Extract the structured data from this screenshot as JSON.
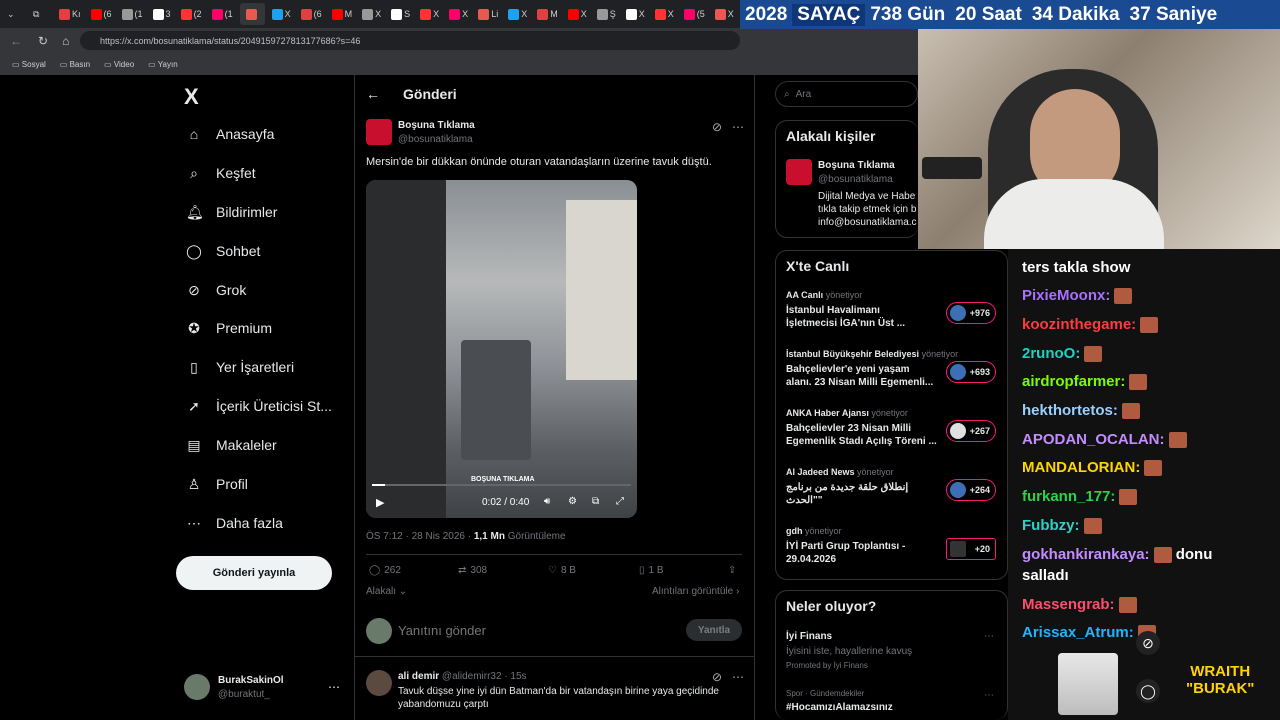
{
  "browser": {
    "tabs": [
      "Kı",
      "(6",
      "(1",
      "3",
      "(2",
      "(1",
      "",
      "X",
      "(6",
      "M",
      "X",
      "S",
      "X",
      "X",
      "Li",
      "X",
      "M",
      "X",
      "Ş",
      "X",
      "X",
      "(5",
      "X",
      "X",
      "X",
      "X",
      "X"
    ],
    "url": "https://x.com/bosunatiklama/status/2049159727813177686?s=46",
    "bookmarks": [
      "Sosyal",
      "Basın",
      "Video",
      "Yayın"
    ]
  },
  "counter": {
    "year": "2028",
    "label": "SAYAÇ",
    "days": "738 Gün",
    "hours": "20 Saat",
    "minutes": "34 Dakika",
    "seconds": "37 Saniye"
  },
  "sidebar": {
    "logo": "X",
    "items": [
      {
        "label": "Anasayfa",
        "icon": "home-icon"
      },
      {
        "label": "Keşfet",
        "icon": "search-icon"
      },
      {
        "label": "Bildirimler",
        "icon": "bell-icon"
      },
      {
        "label": "Sohbet",
        "icon": "chat-icon"
      },
      {
        "label": "Grok",
        "icon": "grok-icon"
      },
      {
        "label": "Premium",
        "icon": "verified-icon"
      },
      {
        "label": "Yer İşaretleri",
        "icon": "bookmark-icon"
      },
      {
        "label": "İçerik Üreticisi St...",
        "icon": "rocket-icon"
      },
      {
        "label": "Makaleler",
        "icon": "article-icon"
      },
      {
        "label": "Profil",
        "icon": "person-icon"
      },
      {
        "label": "Daha fazla",
        "icon": "more-icon"
      }
    ],
    "post_button": "Gönderi yayınla",
    "account": {
      "name": "BurakSakinOl",
      "handle": "@buraktut_"
    }
  },
  "post": {
    "header": "Gönderi",
    "author": "Boşuna Tıklama",
    "handle": "@bosunatiklama",
    "text": "Mersin'de bir dükkan önünde oturan vatandaşların üzerine tavuk düştü.",
    "video": {
      "time": "0:02 / 0:40",
      "progress": 0.05,
      "watermark": "BOŞUNA TIKLAMA"
    },
    "meta_time": "ÖS 7:12 · 28 Nis 2026 ·",
    "views": "1,1 Mn",
    "views_label": "Görüntüleme",
    "stats": {
      "replies": "262",
      "reposts": "308",
      "likes": "8 B",
      "bookmarks": "1 B"
    },
    "sort": "Alakalı",
    "quotes": "Alıntıları görüntüle",
    "reply_placeholder": "Yanıtını gönder",
    "reply_button": "Yanıtla"
  },
  "reply": {
    "author": "ali demir",
    "handle": "@alidemirr32 · 15s",
    "text": "Tavuk düşse yine iyi dün Batman'da bir vatandaşın birine yaya geçidinde yabandomuzu çarptı"
  },
  "right": {
    "search_placeholder": "Ara",
    "related_title": "Alakalı kişiler",
    "related": {
      "name": "Boşuna Tıklama",
      "handle": "@bosunatiklama",
      "bio1": "Dijital Medya ve Habe",
      "bio2": "tıkla takip etmek için b",
      "bio3": "info@bosunatiklama.c"
    },
    "live_title": "X'te Canlı",
    "live": [
      {
        "source": "AA Canlı",
        "role": "yönetiyor",
        "text1": "İstanbul Havalimanı",
        "text2": "İşletmecisi İGA'nın Üst ...",
        "count": "+976"
      },
      {
        "source": "İstanbul Büyükşehir Belediyesi",
        "role": "yönetiyor",
        "text1": "Bahçelievler'e yeni yaşam",
        "text2": "alanı. 23 Nisan Milli Egemenli...",
        "count": "+693"
      },
      {
        "source": "ANKA Haber Ajansı",
        "role": "yönetiyor",
        "text1": "Bahçelievler 23 Nisan Milli",
        "text2": "Egemenlik Stadı Açılış Töreni ...",
        "count": "+267"
      },
      {
        "source": "Al Jadeed News",
        "role": "yönetiyor",
        "text1": "إنطلاق حلقة جديدة من برنامج",
        "text2": "الحدث\"\"",
        "count": "+264"
      },
      {
        "source": "gdh",
        "role": "yönetiyor",
        "text1": "İYİ Parti Grup Toplantısı -",
        "text2": "29.04.2026",
        "count": "+20"
      }
    ],
    "happening_title": "Neler oluyor?",
    "happening": [
      {
        "title": "İyi Finans",
        "sub": "İyisini iste, hayallerine kavuş",
        "promo": "Promoted by İyi Finans"
      },
      {
        "title": "#HocamızıAlamazsınız",
        "sub": "Spor · Gündemdekiler"
      }
    ]
  },
  "chat": {
    "title": "ters takla show",
    "lines": [
      {
        "user": "PixieMoonx:",
        "color": "#a970ff",
        "msg": ""
      },
      {
        "user": "koozinthegame:",
        "color": "#ff3b3b",
        "msg": ""
      },
      {
        "user": "2runoO:",
        "color": "#1fd1c2",
        "msg": ""
      },
      {
        "user": "airdropfarmer:",
        "color": "#7cfc00",
        "msg": ""
      },
      {
        "user": "hekthortetos:",
        "color": "#9ad0ff",
        "msg": ""
      },
      {
        "user": "APODAN_OCALAN:",
        "color": "#c38cff",
        "msg": ""
      },
      {
        "user": "MANDALORIAN:",
        "color": "#ffd400",
        "msg": ""
      },
      {
        "user": "furkann_177:",
        "color": "#2fd14a",
        "msg": ""
      },
      {
        "user": "Fubbzy:",
        "color": "#2fd1c7",
        "msg": ""
      },
      {
        "user": "gokhankirankaya:",
        "color": "#c38cff",
        "msg": "donu"
      },
      {
        "user": "",
        "color": "#ffffff",
        "msg": "salladı"
      },
      {
        "user": "Massengrab:",
        "color": "#ff4d6d",
        "msg": ""
      },
      {
        "user": "Arissax_Atrum:",
        "color": "#1fb5ff",
        "msg": ""
      }
    ],
    "brand1": "WRAITH",
    "brand2": "\"BURAK\""
  }
}
